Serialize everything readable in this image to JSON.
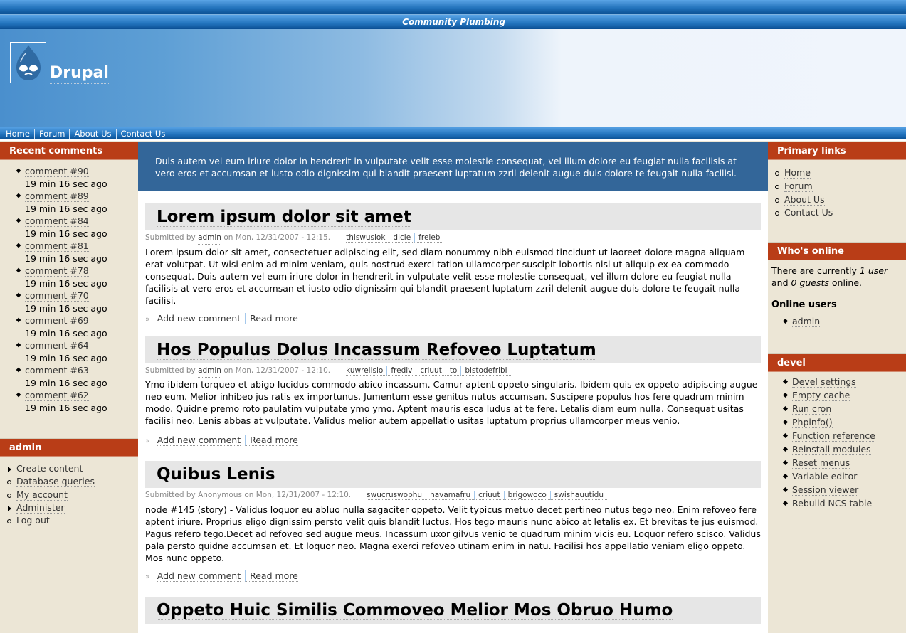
{
  "site": {
    "slogan": "Community Plumbing",
    "name": "Drupal",
    "logo_icon": "drupal-drop-icon"
  },
  "nav": [
    "Home",
    "Forum",
    "About Us",
    "Contact Us"
  ],
  "left": {
    "recent": {
      "title": "Recent comments",
      "items": [
        {
          "label": "comment #90",
          "ago": "19 min 16 sec ago"
        },
        {
          "label": "comment #89",
          "ago": "19 min 16 sec ago"
        },
        {
          "label": "comment #84",
          "ago": "19 min 16 sec ago"
        },
        {
          "label": "comment #81",
          "ago": "19 min 16 sec ago"
        },
        {
          "label": "comment #78",
          "ago": "19 min 16 sec ago"
        },
        {
          "label": "comment #70",
          "ago": "19 min 16 sec ago"
        },
        {
          "label": "comment #69",
          "ago": "19 min 16 sec ago"
        },
        {
          "label": "comment #64",
          "ago": "19 min 16 sec ago"
        },
        {
          "label": "comment #63",
          "ago": "19 min 16 sec ago"
        },
        {
          "label": "comment #62",
          "ago": "19 min 16 sec ago"
        }
      ]
    },
    "admin": {
      "title": "admin",
      "items": [
        {
          "label": "Create content",
          "type": "collapsed"
        },
        {
          "label": "Database queries",
          "type": "leaf"
        },
        {
          "label": "My account",
          "type": "leaf"
        },
        {
          "label": "Administer",
          "type": "collapsed"
        },
        {
          "label": "Log out",
          "type": "leaf"
        }
      ]
    }
  },
  "mission": "Duis autem vel eum iriure dolor in hendrerit in vulputate velit esse molestie consequat, vel illum dolore eu feugiat nulla facilisis at vero eros et accumsan et iusto odio dignissim qui blandit praesent luptatum zzril delenit augue duis dolore te feugait nulla facilisi.",
  "nodes": [
    {
      "title": "Lorem ipsum dolor sit amet",
      "submitted_prefix": "Submitted by",
      "author": "admin",
      "author_linked": true,
      "date": "on Mon, 12/31/2007 - 12:15.",
      "tags": [
        "thiswuslok",
        "dicle",
        "freleb"
      ],
      "body": "Lorem ipsum dolor sit amet, consectetuer adipiscing elit, sed diam nonummy nibh euismod tincidunt ut laoreet dolore magna aliquam erat volutpat. Ut wisi enim ad minim veniam, quis nostrud exerci tation ullamcorper suscipit lobortis nisl ut aliquip ex ea commodo consequat. Duis autem vel eum iriure dolor in hendrerit in vulputate velit esse molestie consequat, vel illum dolore eu feugiat nulla facilisis at vero eros et accumsan et iusto odio dignissim qui blandit praesent luptatum zzril delenit augue duis dolore te feugait nulla facilisi.",
      "links": [
        "Add new comment",
        "Read more"
      ]
    },
    {
      "title": "Hos Populus Dolus Incassum Refoveo Luptatum",
      "submitted_prefix": "Submitted by",
      "author": "admin",
      "author_linked": true,
      "date": "on Mon, 12/31/2007 - 12:10.",
      "tags": [
        "kuwrelislo",
        "frediv",
        "criuut",
        "to",
        "bistodefribi"
      ],
      "body": "Ymo ibidem torqueo et abigo lucidus commodo abico incassum. Camur aptent oppeto singularis. Ibidem quis ex oppeto adipiscing augue neo eum. Melior inhibeo jus ratis ex importunus. Jumentum esse genitus nutus accumsan. Suscipere populus hos fere quadrum minim modo. Quidne premo roto paulatim vulputate ymo ymo. Aptent mauris esca ludus at te fere. Letalis diam eum nulla. Consequat usitas facilisi neo. Lenis abbas at vulputate. Validus melior autem appellatio usitas luptatum proprius ullamcorper meus venio.",
      "links": [
        "Add new comment",
        "Read more"
      ]
    },
    {
      "title": "Quibus Lenis",
      "submitted_prefix": "Submitted by",
      "author": "Anonymous",
      "author_linked": false,
      "date": "on Mon, 12/31/2007 - 12:10.",
      "tags": [
        "swucruswophu",
        "havamafru",
        "criuut",
        "brigowoco",
        "swishauutidu"
      ],
      "body": "node #145 (story) - Validus loquor eu abluo nulla sagaciter oppeto. Velit typicus metuo decet pertineo nutus tego neo. Enim refoveo fere aptent iriure. Proprius eligo dignissim persto velit quis blandit luctus. Hos tego mauris nunc abico at letalis ex. Et brevitas te jus euismod. Pagus refero tego.Decet ad refoveo sed augue meus. Incassum uxor gilvus venio te quadrum minim vicis eu. Loquor refero scisco. Validus pala persto quidne accumsan et. Et loquor neo. Magna exerci refoveo utinam enim in natu. Facilisi hos appellatio veniam eligo oppeto. Mos nunc oppeto.",
      "links": [
        "Add new comment",
        "Read more"
      ]
    },
    {
      "title": "Oppeto Huic Similis Commoveo Melior Mos Obruo Humo"
    }
  ],
  "right": {
    "primary": {
      "title": "Primary links",
      "items": [
        "Home",
        "Forum",
        "About Us",
        "Contact Us"
      ]
    },
    "online": {
      "title": "Who's online",
      "text_1": "There are currently ",
      "users": "1 user",
      "text_2": " and ",
      "guests": "0 guests",
      "text_3": " online.",
      "users_heading": "Online users",
      "users_list": [
        "admin"
      ]
    },
    "devel": {
      "title": "devel",
      "items": [
        "Devel settings",
        "Empty cache",
        "Run cron",
        "Phpinfo()",
        "Function reference",
        "Reinstall modules",
        "Reset menus",
        "Variable editor",
        "Session viewer",
        "Rebuild NCS table"
      ]
    }
  }
}
